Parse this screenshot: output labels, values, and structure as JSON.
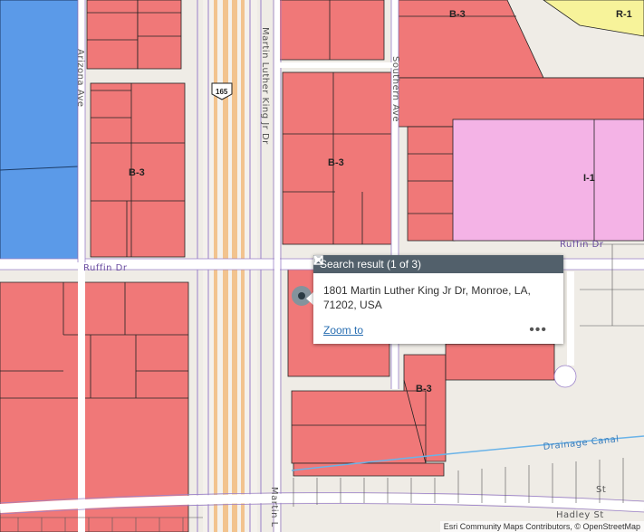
{
  "zones": {
    "b3_north": "B-3",
    "b3_west": "B-3",
    "b3_center": "B-3",
    "b3_south": "B-3",
    "r1": "R-1",
    "i1": "I-1"
  },
  "streets": {
    "arizona": "Arizona Ave",
    "mlk_north": "Martin Luther King Jr Dr",
    "mlk_south": "Martin L",
    "southern": "Southern Ave",
    "ruffin_west": "Ruffin Dr",
    "ruffin_east": "Ruffin Dr",
    "drainage": "Drainage Canal",
    "hadley": "Hadley St",
    "st_fragment": "St"
  },
  "highway_shield": "165",
  "popup": {
    "title": "Search result (1 of 3)",
    "address": "1801 Martin Luther King Jr Dr, Monroe, LA, 71202, USA",
    "zoom_to": "Zoom to",
    "more": "•••"
  },
  "attribution": "Esri Community Maps Contributors, © OpenStreetMap",
  "colors": {
    "b3": "#f07878",
    "i1": "#f4b3e6",
    "r1": "#f7f39a",
    "blue_zone": "#5b9ae8"
  }
}
